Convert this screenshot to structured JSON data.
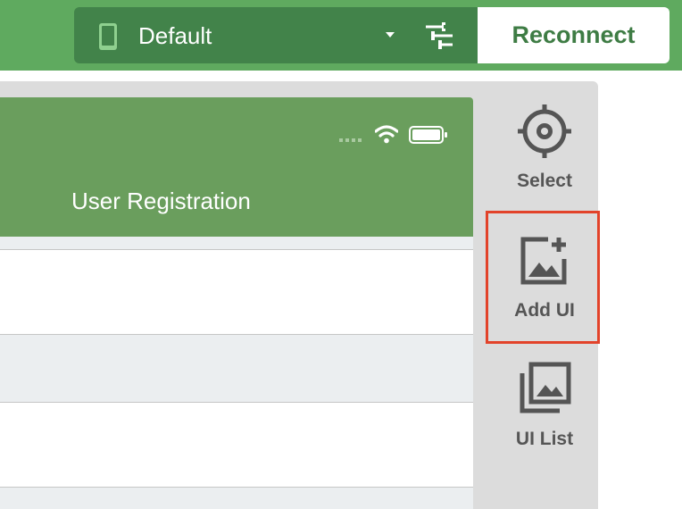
{
  "toolbar": {
    "device": {
      "label": "Default",
      "icon": "phone-icon",
      "dropdown_icon": "caret-down-icon"
    },
    "settings_icon": "tune-icon",
    "reconnect_label": "Reconnect"
  },
  "preview": {
    "status_bar": {
      "icons": [
        "signal-icon",
        "wifi-icon",
        "battery-icon"
      ]
    },
    "title": "User Registration"
  },
  "side_tools": [
    {
      "label": "Select",
      "icon": "crosshair-icon"
    },
    {
      "label": "Add UI",
      "icon": "add-image-icon",
      "highlighted": true
    },
    {
      "label": "UI List",
      "icon": "image-stack-icon"
    }
  ],
  "colors": {
    "topbar": "#5faa5f",
    "device_bar": "#42834a",
    "app_header": "#6a9e5d",
    "accent_text": "#3e7c44",
    "highlight": "#e2432a"
  }
}
